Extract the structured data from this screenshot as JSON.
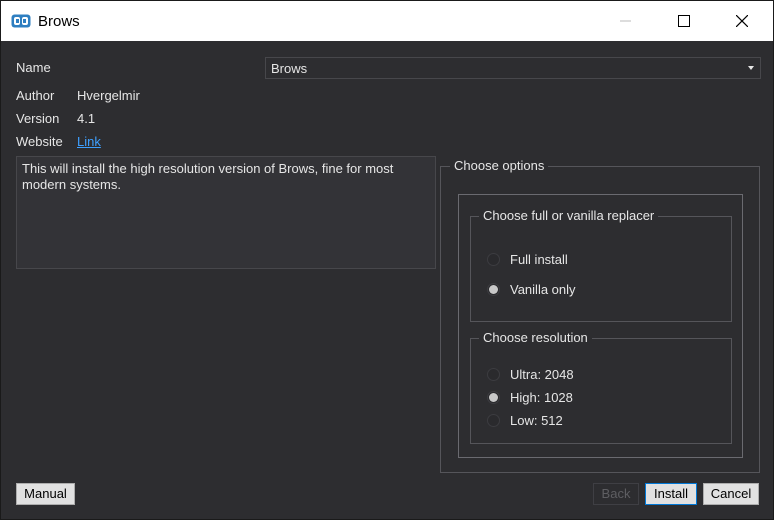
{
  "window": {
    "title": "Brows",
    "app_icon": "brows-logo-icon"
  },
  "fields": {
    "name_label": "Name",
    "author_label": "Author",
    "author_value": "Hvergelmir",
    "version_label": "Version",
    "version_value": "4.1",
    "website_label": "Website",
    "website_link": "Link"
  },
  "name_select": {
    "selected": "Brows"
  },
  "description": "This will install the high resolution version of Brows, fine for most modern systems.",
  "options": {
    "title": "Choose options",
    "replacer_group": {
      "title": "Choose full or vanilla replacer",
      "items": [
        {
          "label": "Full install",
          "checked": false
        },
        {
          "label": "Vanilla only",
          "checked": true
        }
      ]
    },
    "resolution_group": {
      "title": "Choose resolution",
      "items": [
        {
          "label": "Ultra: 2048",
          "checked": false
        },
        {
          "label": "High: 1028",
          "checked": true
        },
        {
          "label": "Low: 512",
          "checked": false
        }
      ]
    }
  },
  "buttons": {
    "manual": "Manual",
    "back": "Back",
    "install": "Install",
    "cancel": "Cancel"
  },
  "colors": {
    "background": "#2d2d30",
    "link": "#3ea0ff",
    "text": "#e6e6e6"
  }
}
